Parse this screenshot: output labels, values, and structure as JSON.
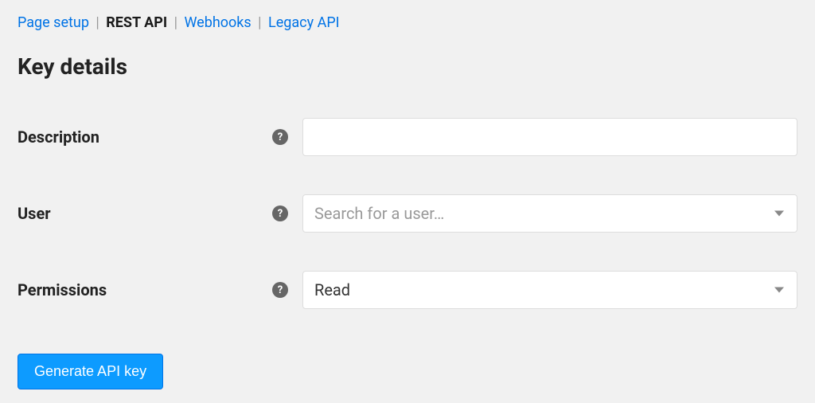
{
  "tabs": {
    "page_setup": "Page setup",
    "rest_api": "REST API",
    "webhooks": "Webhooks",
    "legacy_api": "Legacy API"
  },
  "title": "Key details",
  "form": {
    "description_label": "Description",
    "description_value": "",
    "user_label": "User",
    "user_placeholder": "Search for a user…",
    "permissions_label": "Permissions",
    "permissions_value": "Read"
  },
  "button": {
    "generate": "Generate API key"
  },
  "help_icon_char": "?"
}
